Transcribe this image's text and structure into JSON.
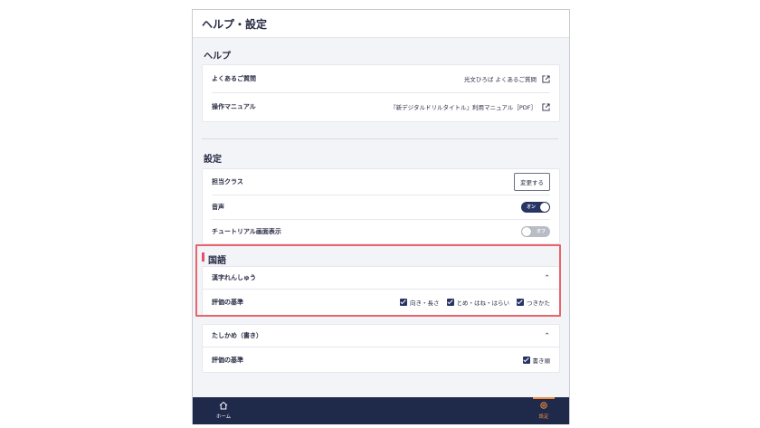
{
  "header": {
    "title": "ヘルプ・設定"
  },
  "help": {
    "section_title": "ヘルプ",
    "rows": [
      {
        "label": "よくあるご質問",
        "value": "光文ひろば よくあるご質問"
      },
      {
        "label": "操作マニュアル",
        "value": "『新デジタルドリルタイトル』利用マニュアル［PDF］"
      }
    ]
  },
  "settings": {
    "section_title": "設定",
    "class_label": "担当クラス",
    "class_button": "変更する",
    "sound_label": "音声",
    "sound_toggle": "オン",
    "tutorial_label": "チュートリアル画面表示",
    "tutorial_toggle": "オフ"
  },
  "kokugo": {
    "section_title": "国語",
    "accent_color": "#e64f6a",
    "kanji_group": {
      "title": "漢字れんしゅう",
      "criteria_label": "評価の基準",
      "options": [
        "向き・長さ",
        "とめ・はね・はらい",
        "つきかた"
      ]
    },
    "kakitori_group": {
      "title": "たしかめ（書き）",
      "criteria_label": "評価の基準",
      "options": [
        "書き順"
      ]
    }
  },
  "bottom_nav": {
    "home": "ホーム",
    "settings": "設定",
    "active_color": "#f08a3c",
    "bar_color": "#1f2a4a"
  },
  "colors": {
    "primary": "#283564",
    "highlight": "#e8656b"
  }
}
